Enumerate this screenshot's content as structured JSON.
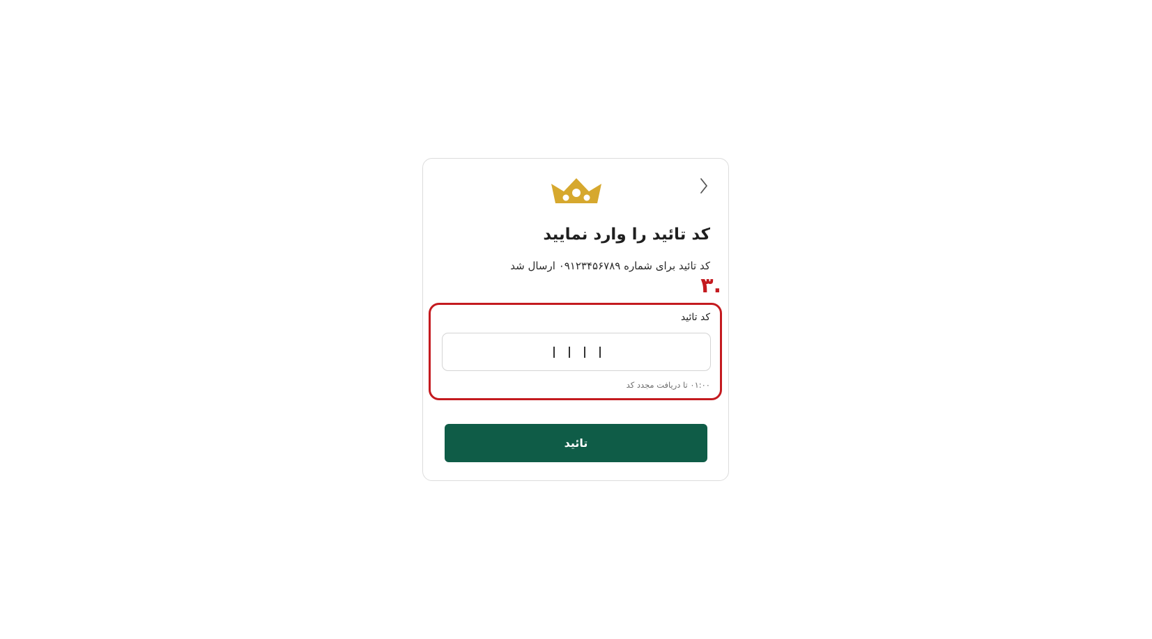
{
  "card": {
    "back_icon": "chevron-right-icon",
    "logo_icon": "crown-icon",
    "logo_color": "#d6a82e",
    "title": "کد تائید را وارد نمایید",
    "subtitle": "کد تائید برای شماره ۰۹۱۲۳۴۵۶۷۸۹ ارسال شد"
  },
  "annotation": {
    "step_number": ".۳",
    "highlight_color": "#c41a1f"
  },
  "code_field": {
    "label": "کد تائید",
    "digit_count": 4,
    "value": "",
    "countdown": "۰۱:۰۰ تا دریافت مجدد کد"
  },
  "submit": {
    "label": "تائید",
    "color": "#0f5c47"
  }
}
